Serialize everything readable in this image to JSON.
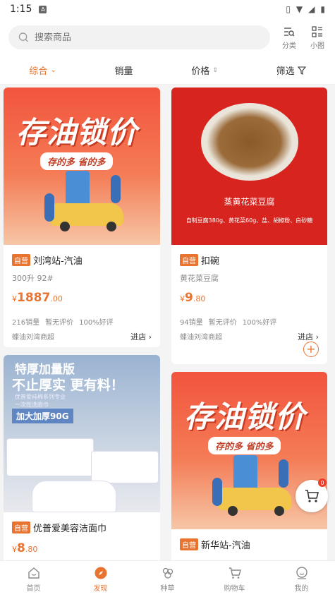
{
  "status": {
    "time": "1:15",
    "badge": "A"
  },
  "search": {
    "placeholder": "搜索商品"
  },
  "header_buttons": [
    {
      "label": "分类",
      "icon": "category-icon"
    },
    {
      "label": "小图",
      "icon": "grid-view-icon"
    }
  ],
  "filters": {
    "comprehensive": "综合",
    "sales": "销量",
    "price": "价格",
    "filter": "筛选"
  },
  "products": [
    {
      "tag": "自营",
      "title": "刘湾站-汽油",
      "spec": "300升 92#",
      "currency": "¥",
      "price_int": "1887",
      "price_dec": ".00",
      "sales": "216销量",
      "review": "暂无评价",
      "good": "100%好评",
      "store": "蝶油刘湾商超",
      "go": "进店 ›",
      "banner_main": "存油锁价",
      "banner_ribbon": "存的多  省的多"
    },
    {
      "tag": "自营",
      "title": "扣碗",
      "spec": "黄花菜豆腐",
      "currency": "¥",
      "price_int": "9",
      "price_dec": ".80",
      "sales": "94销量",
      "review": "暂无评价",
      "good": "100%好评",
      "store": "蝶油刘湾商超",
      "go": "进店 ›",
      "banner_title": "蒸黄花菜豆腐",
      "banner_sub": "自制豆腐380g、黄花菜60g、盐、胡椒粉、白砂糖"
    },
    {
      "tag": "自营",
      "title": "优普爱美容洁面巾",
      "currency": "¥",
      "price_int": "8",
      "price_dec": ".80",
      "banner_h1": "特厚加量版",
      "banner_h2": "不止厚实 更有料！",
      "banner_small1": "优普爱纯棉系列专业",
      "banner_small2": "一次性洗脸巾",
      "banner_pill": "加大加厚90G"
    },
    {
      "tag": "自营",
      "title": "新华站-汽油",
      "banner_main": "存油锁价",
      "banner_ribbon": "存的多  省的多"
    }
  ],
  "cart_badge": "0",
  "tabbar": [
    {
      "label": "首页",
      "icon": "home-icon"
    },
    {
      "label": "发现",
      "icon": "discover-icon",
      "active": true
    },
    {
      "label": "种草",
      "icon": "seed-icon"
    },
    {
      "label": "购物车",
      "icon": "cart-icon"
    },
    {
      "label": "我的",
      "icon": "profile-icon"
    }
  ],
  "colors": {
    "accent": "#e8742f",
    "banner_red": "#d7241f"
  }
}
